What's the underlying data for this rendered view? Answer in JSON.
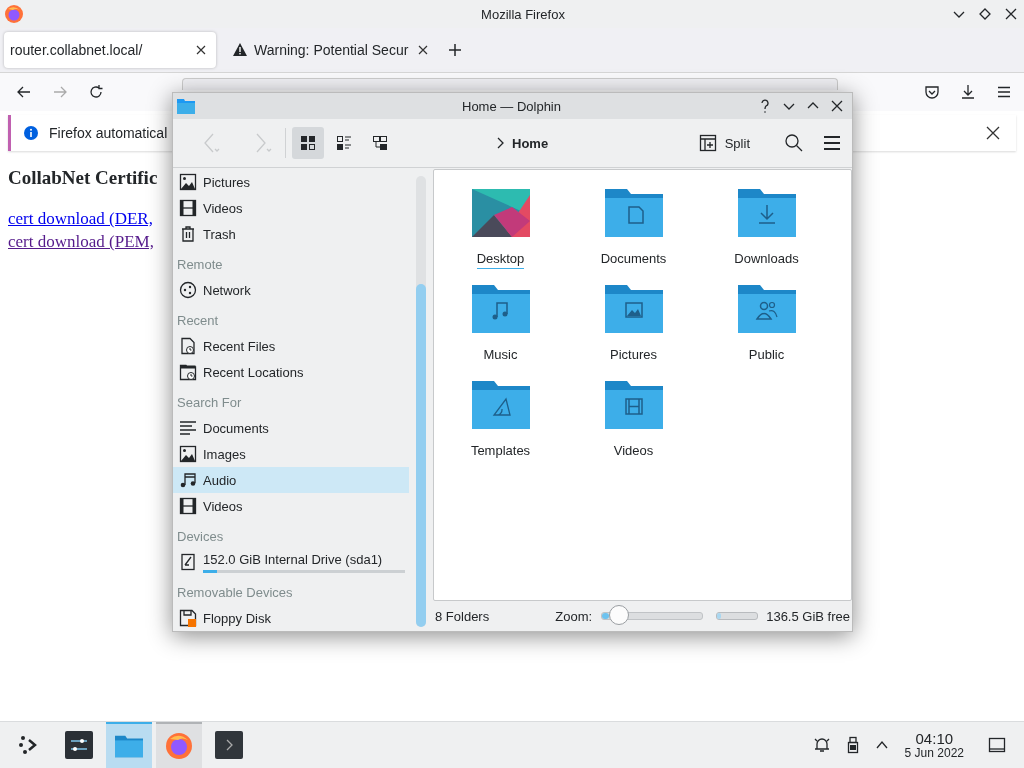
{
  "firefox": {
    "title": "Mozilla Firefox",
    "tabs": [
      {
        "label": "router.collabnet.local/",
        "selected": true,
        "warning": false
      },
      {
        "label": "Warning: Potential Secur",
        "selected": false,
        "warning": true
      }
    ],
    "notification": {
      "text": "Firefox automatical"
    },
    "page": {
      "heading": "CollabNet Certific",
      "links": [
        {
          "text": "cert download (DER,",
          "visited": false
        },
        {
          "text": "cert download (PEM,",
          "visited": true
        }
      ]
    }
  },
  "dolphin": {
    "title": "Home — Dolphin",
    "view_modes": [
      {
        "kind": "icons",
        "selected": true
      },
      {
        "kind": "compact",
        "selected": false
      },
      {
        "kind": "details",
        "selected": false
      }
    ],
    "breadcrumb": "Home",
    "split_label": "Split",
    "sidebar": [
      {
        "kind": "pictures",
        "label": "Pictures",
        "selected": false
      },
      {
        "kind": "videos",
        "label": "Videos",
        "selected": false
      },
      {
        "kind": "trash",
        "label": "Trash",
        "selected": false
      },
      {
        "kind": "heading",
        "label": "Remote"
      },
      {
        "kind": "network",
        "label": "Network",
        "selected": false
      },
      {
        "kind": "heading",
        "label": "Recent"
      },
      {
        "kind": "recent-files",
        "label": "Recent Files",
        "selected": false
      },
      {
        "kind": "recent-locations",
        "label": "Recent Locations",
        "selected": false
      },
      {
        "kind": "heading",
        "label": "Search For"
      },
      {
        "kind": "documents",
        "label": "Documents",
        "selected": false
      },
      {
        "kind": "pictures",
        "label": "Images",
        "selected": false
      },
      {
        "kind": "audio",
        "label": "Audio",
        "selected": true
      },
      {
        "kind": "videos",
        "label": "Videos",
        "selected": false
      },
      {
        "kind": "heading",
        "label": "Devices"
      },
      {
        "kind": "drive",
        "label": "152.0 GiB Internal Drive (sda1)",
        "selected": false,
        "level": 0.07
      },
      {
        "kind": "heading",
        "label": "Removable Devices"
      },
      {
        "kind": "floppy",
        "label": "Floppy Disk",
        "selected": false
      }
    ],
    "files": [
      {
        "name": "Desktop",
        "kind": "desktop",
        "focused": true
      },
      {
        "name": "Documents",
        "kind": "documents",
        "focused": false
      },
      {
        "name": "Downloads",
        "kind": "downloads",
        "focused": false
      },
      {
        "name": "Music",
        "kind": "music",
        "focused": false
      },
      {
        "name": "Pictures",
        "kind": "pictures",
        "focused": false
      },
      {
        "name": "Public",
        "kind": "public",
        "focused": false
      },
      {
        "name": "Templates",
        "kind": "templates",
        "focused": false
      },
      {
        "name": "Videos",
        "kind": "videos",
        "focused": false
      }
    ],
    "status": {
      "text": "8 Folders",
      "zoom_label": "Zoom:",
      "zoom": {
        "level": 0.18
      },
      "free_space": {
        "level": 0.1
      },
      "free_text": "136.5 GiB free"
    }
  },
  "taskbar": {
    "tasks": [
      {
        "kind": "launcher",
        "selected": false,
        "open": false
      },
      {
        "kind": "settings",
        "selected": false,
        "open": false
      },
      {
        "kind": "files",
        "selected": true,
        "open": true
      },
      {
        "kind": "browser",
        "selected": false,
        "open": true
      },
      {
        "kind": "terminal",
        "selected": false,
        "open": false
      }
    ],
    "time": "04:10",
    "date": "5 Jun 2022"
  }
}
